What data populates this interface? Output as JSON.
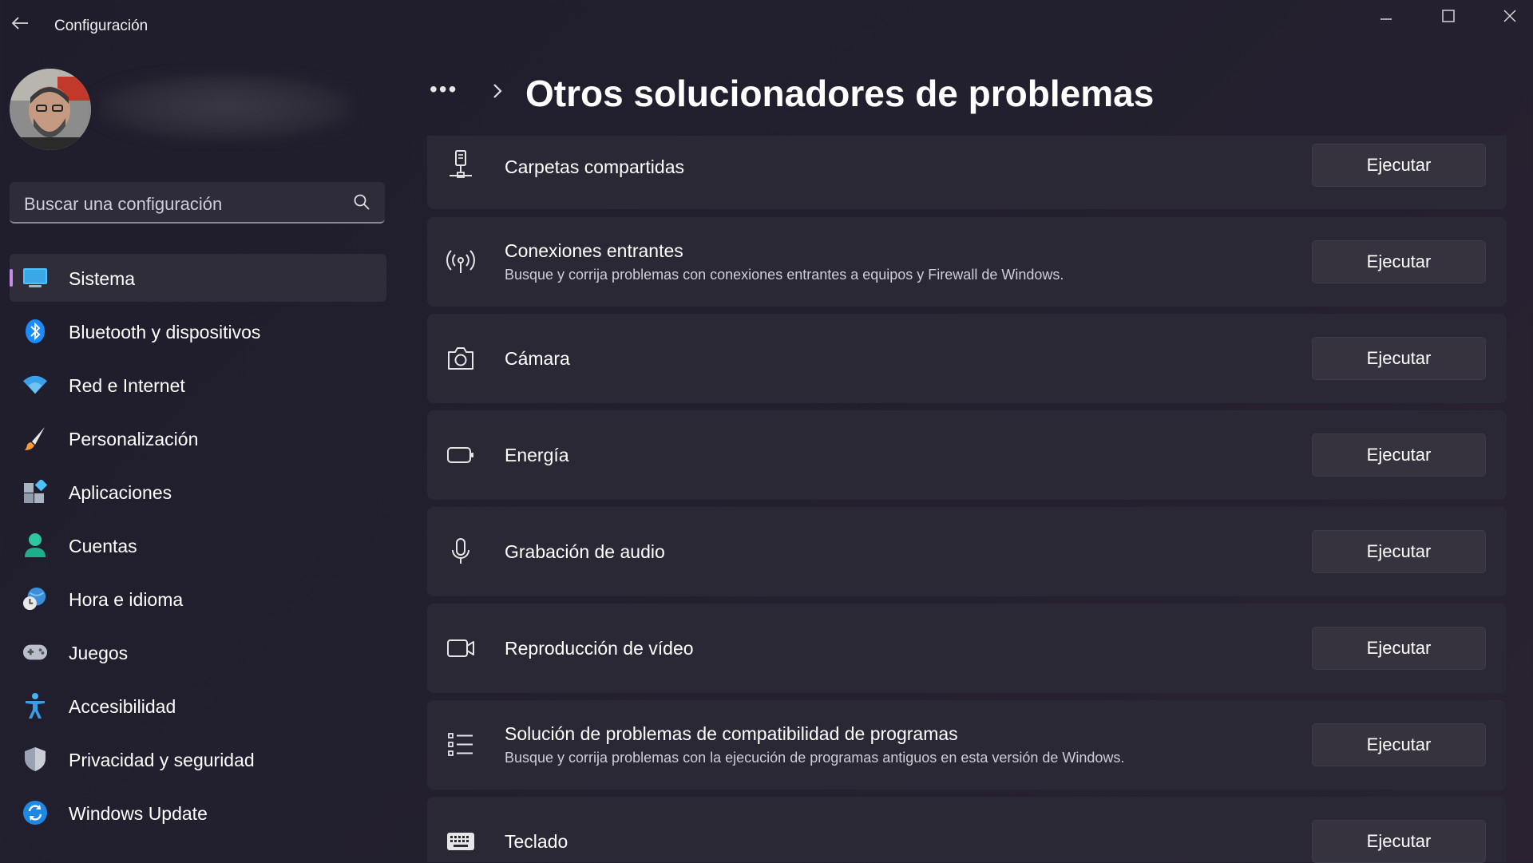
{
  "window": {
    "title": "Configuración"
  },
  "sidebar": {
    "search": {
      "placeholder": "Buscar una configuración"
    },
    "items": [
      {
        "label": "Sistema",
        "icon": "monitor-icon",
        "active": true
      },
      {
        "label": "Bluetooth y dispositivos",
        "icon": "bluetooth-icon"
      },
      {
        "label": "Red e Internet",
        "icon": "wifi-icon"
      },
      {
        "label": "Personalización",
        "icon": "brush-icon"
      },
      {
        "label": "Aplicaciones",
        "icon": "apps-icon"
      },
      {
        "label": "Cuentas",
        "icon": "account-icon"
      },
      {
        "label": "Hora e idioma",
        "icon": "clock-globe-icon"
      },
      {
        "label": "Juegos",
        "icon": "gamepad-icon"
      },
      {
        "label": "Accesibilidad",
        "icon": "accessibility-icon"
      },
      {
        "label": "Privacidad y seguridad",
        "icon": "shield-icon"
      },
      {
        "label": "Windows Update",
        "icon": "update-icon"
      }
    ]
  },
  "header": {
    "breadcrumb_more": "•••",
    "title": "Otros solucionadores de problemas"
  },
  "troubleshooters": [
    {
      "title": "Carpetas compartidas",
      "description": "",
      "button": "Ejecutar",
      "icon": "shared-folder-icon"
    },
    {
      "title": "Conexiones entrantes",
      "description": "Busque y corrija problemas con conexiones entrantes a equipos y Firewall de Windows.",
      "button": "Ejecutar",
      "icon": "broadcast-icon"
    },
    {
      "title": "Cámara",
      "description": "",
      "button": "Ejecutar",
      "icon": "camera-icon"
    },
    {
      "title": "Energía",
      "description": "",
      "button": "Ejecutar",
      "icon": "battery-icon"
    },
    {
      "title": "Grabación de audio",
      "description": "",
      "button": "Ejecutar",
      "icon": "microphone-icon"
    },
    {
      "title": "Reproducción de vídeo",
      "description": "",
      "button": "Ejecutar",
      "icon": "video-icon"
    },
    {
      "title": "Solución de problemas de compatibilidad de programas",
      "description": "Busque y corrija problemas con la ejecución de programas antiguos en esta versión de Windows.",
      "button": "Ejecutar",
      "icon": "list-icon"
    },
    {
      "title": "Teclado",
      "description": "",
      "button": "Ejecutar",
      "icon": "keyboard-icon"
    }
  ],
  "colors": {
    "accent": "#c98be8",
    "card": "#2b2835",
    "button": "#36333f",
    "background": "#211f2d"
  }
}
